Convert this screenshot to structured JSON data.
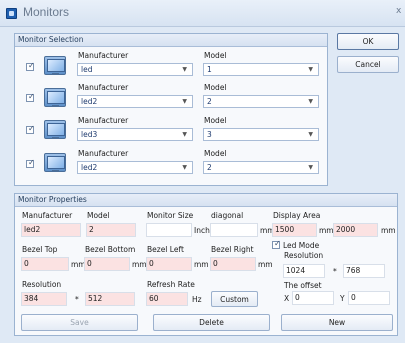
{
  "window": {
    "title": "Monitors",
    "close_glyph": "x"
  },
  "selection": {
    "header": "Monitor Selection",
    "manufacturer_label": "Manufacturer",
    "model_label": "Model",
    "rows": [
      {
        "checked": true,
        "manufacturer": "led",
        "model": "1"
      },
      {
        "checked": true,
        "manufacturer": "led2",
        "model": "2"
      },
      {
        "checked": true,
        "manufacturer": "led3",
        "model": "3"
      },
      {
        "checked": true,
        "manufacturer": "led2",
        "model": "2"
      }
    ]
  },
  "dialog_buttons": {
    "ok": "OK",
    "cancel": "Cancel"
  },
  "properties": {
    "header": "Monitor Properties",
    "labels": {
      "manufacturer": "Manufacturer",
      "model": "Model",
      "monitor_size": "Monitor Size",
      "diagonal": "diagonal",
      "display_area": "Display Area",
      "bezel_top": "Bezel Top",
      "bezel_bottom": "Bezel Bottom",
      "bezel_left": "Bezel Left",
      "bezel_right": "Bezel Right",
      "led_mode": "Led Mode",
      "resolution": "Resolution",
      "refresh_rate": "Refresh Rate",
      "offset": "The offset",
      "offset_x": "X",
      "offset_y": "Y"
    },
    "units": {
      "inch": "Inch",
      "mm": "mm",
      "hz": "Hz",
      "times": "*"
    },
    "values": {
      "manufacturer": "led2",
      "model": "2",
      "monitor_size": "",
      "diagonal": "",
      "display_w": "1500",
      "display_h": "2000",
      "bezel_top": "0",
      "bezel_bottom": "0",
      "bezel_left": "0",
      "bezel_right": "0",
      "led_mode_checked": true,
      "led_res_w": "1024",
      "led_res_h": "768",
      "res_w": "384",
      "res_h": "512",
      "refresh": "60",
      "offset_x": "0",
      "offset_y": "0"
    },
    "custom_button": "Custom"
  },
  "actions": {
    "save": "Save",
    "delete": "Delete",
    "new": "New"
  }
}
